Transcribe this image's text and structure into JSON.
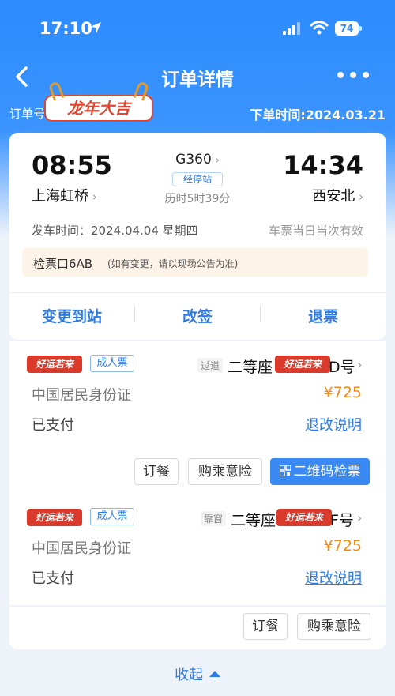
{
  "status_bar": {
    "time": "17:10",
    "battery": "74"
  },
  "nav": {
    "title": "订单详情",
    "more": "•••"
  },
  "order": {
    "order_no_label": "订单号",
    "sticker": "龙年大吉",
    "order_time": "下单时间:2024.03.21"
  },
  "trip": {
    "dep_time": "08:55",
    "arr_time": "14:34",
    "dep_station": "上海虹桥",
    "arr_station": "西安北",
    "train_no": "G360",
    "stops": "经停站",
    "duration": "历时5时39分",
    "depart_date": "发车时间：2024.04.04  星期四",
    "valid": "车票当日当次有效",
    "gate": "检票口6AB",
    "gate_note": "(如有变更，请以现场公告为准)",
    "actions": [
      "变更到站",
      "改签",
      "退票"
    ]
  },
  "passengers": [
    {
      "sticker": "好运若来",
      "ticket_type": "成人票",
      "seat_tag": "过道",
      "seat_class": "二等座",
      "seat_sticker": "好运若来",
      "seat_no_suffix": "D号",
      "id_type": "中国居民身份证",
      "price": "¥725",
      "pay_status": "已支付",
      "refund_link": "退改说明",
      "buttons": [
        "订餐",
        "购乘意险",
        "二维码检票"
      ]
    },
    {
      "sticker": "好运若来",
      "ticket_type": "成人票",
      "seat_tag": "靠窗",
      "seat_class": "二等座",
      "seat_sticker": "好运若来",
      "seat_no_suffix": "F号",
      "id_type": "中国居民身份证",
      "price": "¥725",
      "pay_status": "已支付",
      "refund_link": "退改说明",
      "buttons": [
        "订餐",
        "购乘意险"
      ]
    }
  ],
  "collapse": "收起"
}
